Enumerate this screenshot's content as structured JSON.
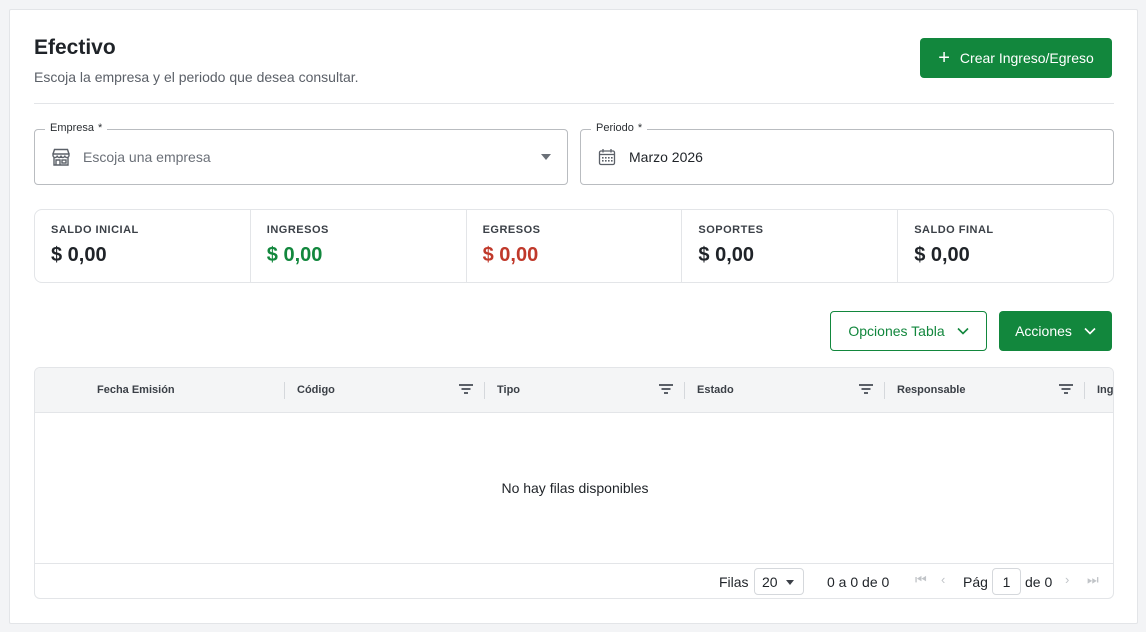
{
  "header": {
    "title": "Efectivo",
    "subtitle": "Escoja la empresa y el periodo que desea consultar.",
    "create_label": "Crear Ingreso/Egreso"
  },
  "filters": {
    "empresa": {
      "label": "Empresa",
      "required": "*",
      "placeholder": "Escoja una empresa"
    },
    "periodo": {
      "label": "Periodo",
      "required": "*",
      "value": "Marzo 2026"
    }
  },
  "stats": [
    {
      "label": "SALDO INICIAL",
      "value": "$ 0,00",
      "color": "#1f2328"
    },
    {
      "label": "INGRESOS",
      "value": "$ 0,00",
      "color": "#12873d"
    },
    {
      "label": "EGRESOS",
      "value": "$ 0,00",
      "color": "#c0392b"
    },
    {
      "label": "SOPORTES",
      "value": "$ 0,00",
      "color": "#1f2328"
    },
    {
      "label": "SALDO FINAL",
      "value": "$ 0,00",
      "color": "#1f2328"
    }
  ],
  "toolbar": {
    "options_label": "Opciones Tabla",
    "actions_label": "Acciones"
  },
  "table": {
    "columns": [
      "Fecha Emisión",
      "Código",
      "Tipo",
      "Estado",
      "Responsable",
      "Ing"
    ],
    "empty_message": "No hay filas disponibles"
  },
  "pagination": {
    "rows_label": "Filas",
    "rows_per_page": "20",
    "range_text": "0 a 0 de 0",
    "page_label": "Pág",
    "current_page": "1",
    "of_text": "de 0"
  },
  "colors": {
    "accent": "#12873d",
    "negative": "#c0392b"
  }
}
